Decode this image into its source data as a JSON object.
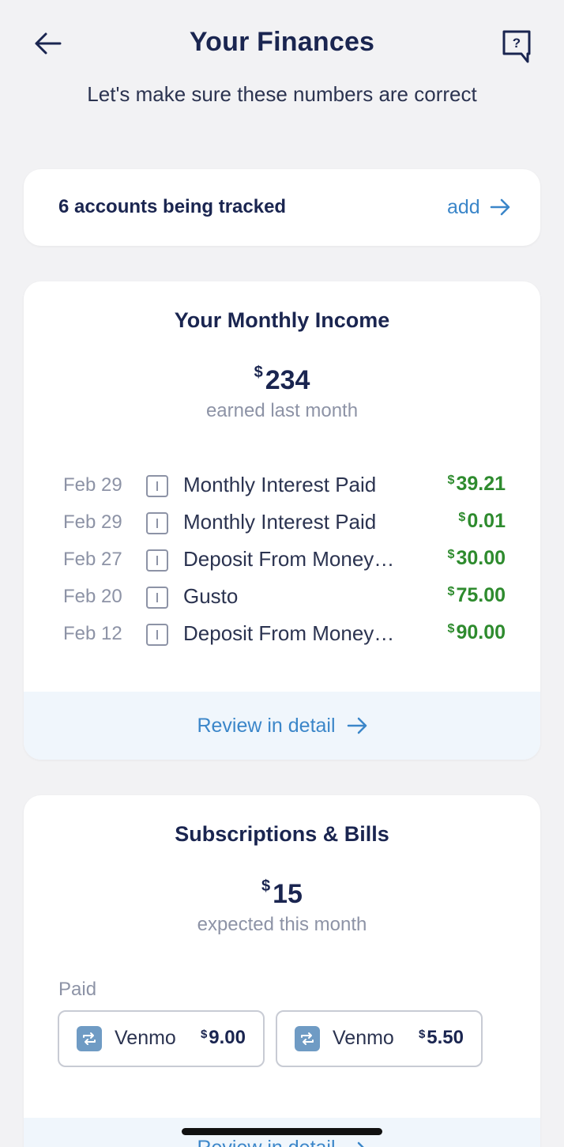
{
  "header": {
    "title": "Your Finances",
    "subtitle": "Let's make sure these numbers are correct",
    "back_icon": "arrow-left-icon",
    "help_icon": "help-chat-icon"
  },
  "accounts": {
    "text": "6 accounts being tracked",
    "add_label": "add"
  },
  "income": {
    "title": "Your Monthly Income",
    "currency": "$",
    "amount": "234",
    "caption": "earned last month",
    "transactions": [
      {
        "date": "Feb 29",
        "description": "Monthly Interest Paid",
        "currency": "$",
        "amount": "39.21"
      },
      {
        "date": "Feb 29",
        "description": "Monthly Interest Paid",
        "currency": "$",
        "amount": "0.01"
      },
      {
        "date": "Feb 27",
        "description": "Deposit From Money…",
        "currency": "$",
        "amount": "30.00"
      },
      {
        "date": "Feb 20",
        "description": "Gusto",
        "currency": "$",
        "amount": "75.00"
      },
      {
        "date": "Feb 12",
        "description": "Deposit From Money…",
        "currency": "$",
        "amount": "90.00"
      }
    ],
    "review_label": "Review in detail"
  },
  "subscriptions": {
    "title": "Subscriptions & Bills",
    "currency": "$",
    "amount": "15",
    "caption": "expected this month",
    "paid_label": "Paid",
    "bills": [
      {
        "name": "Venmo",
        "currency": "$",
        "amount": "9.00",
        "icon": "repeat-icon"
      },
      {
        "name": "Venmo",
        "currency": "$",
        "amount": "5.50",
        "icon": "repeat-icon"
      }
    ],
    "review_label": "Review in detail"
  },
  "colors": {
    "background": "#f2f2f4",
    "primary_text": "#1a2550",
    "accent_link": "#3b86c9",
    "income_green": "#2e8b2e",
    "muted_text": "#8d93a6"
  }
}
